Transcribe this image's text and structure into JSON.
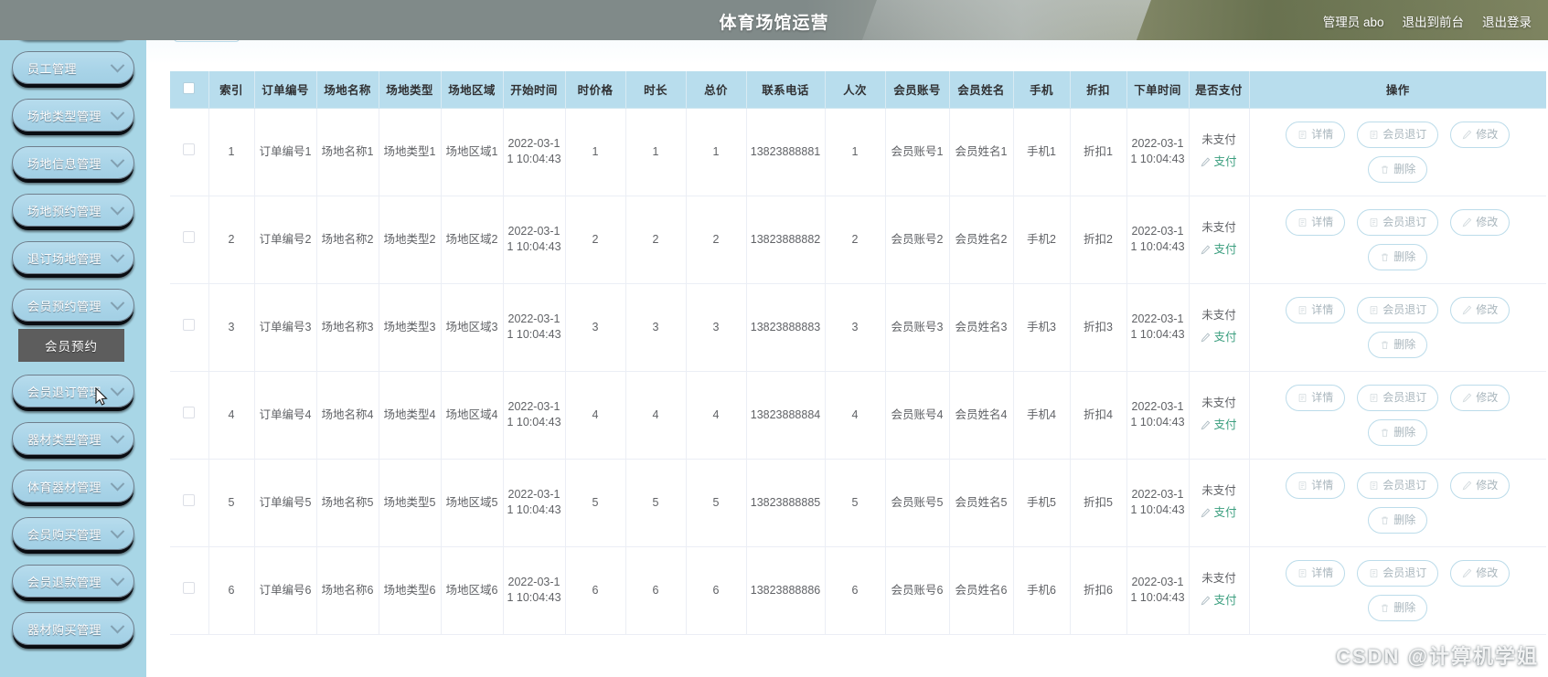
{
  "header": {
    "title": "体育场馆运营",
    "right_items": [
      {
        "label": "管理员 abo",
        "name": "admin-user"
      },
      {
        "label": "退出到前台",
        "name": "exit-to-frontend"
      },
      {
        "label": "退出登录",
        "name": "logout"
      }
    ]
  },
  "sidebar": {
    "items": [
      {
        "label": "员工管理",
        "icon": "chevron-down-icon",
        "expanded": false
      },
      {
        "label": "场地类型管理",
        "icon": "chevron-down-icon",
        "expanded": false
      },
      {
        "label": "场地信息管理",
        "icon": "chevron-down-icon",
        "expanded": false
      },
      {
        "label": "场地预约管理",
        "icon": "chevron-down-icon",
        "expanded": false
      },
      {
        "label": "退订场地管理",
        "icon": "chevron-down-icon",
        "expanded": false
      },
      {
        "label": "会员预约管理",
        "icon": "chevron-down-icon",
        "expanded": true
      },
      {
        "label": "会员退订管理",
        "icon": "chevron-down-icon",
        "expanded": false
      },
      {
        "label": "器材类型管理",
        "icon": "chevron-down-icon",
        "expanded": false
      },
      {
        "label": "体育器材管理",
        "icon": "chevron-down-icon",
        "expanded": false
      },
      {
        "label": "会员购买管理",
        "icon": "chevron-down-icon",
        "expanded": false
      },
      {
        "label": "会员退款管理",
        "icon": "chevron-down-icon",
        "expanded": false
      },
      {
        "label": "器材购买管理",
        "icon": "chevron-down-icon",
        "expanded": false
      }
    ],
    "submenu_after_index": 5,
    "submenu_label": "会员预约"
  },
  "table": {
    "columns": [
      "",
      "索引",
      "订单编号",
      "场地名称",
      "场地类型",
      "场地区域",
      "开始时间",
      "时价格",
      "时长",
      "总价",
      "联系电话",
      "人次",
      "会员账号",
      "会员姓名",
      "手机",
      "折扣",
      "下单时间",
      "是否支付",
      "操作"
    ],
    "rows": [
      {
        "index": "1",
        "order_no": "订单编号1",
        "venue_name": "场地名称1",
        "venue_type": "场地类型1",
        "venue_area": "场地区域1",
        "start_time": "2022-03-11 10:04:43",
        "hour_price": "1",
        "duration": "1",
        "total": "1",
        "phone_contact": "13823888881",
        "person_count": "1",
        "member_account": "会员账号1",
        "member_name": "会员姓名1",
        "mobile": "手机1",
        "discount": "折扣1",
        "order_time": "2022-03-11 10:04:43",
        "pay_state": "未支付",
        "pay_link": "支付"
      },
      {
        "index": "2",
        "order_no": "订单编号2",
        "venue_name": "场地名称2",
        "venue_type": "场地类型2",
        "venue_area": "场地区域2",
        "start_time": "2022-03-11 10:04:43",
        "hour_price": "2",
        "duration": "2",
        "total": "2",
        "phone_contact": "13823888882",
        "person_count": "2",
        "member_account": "会员账号2",
        "member_name": "会员姓名2",
        "mobile": "手机2",
        "discount": "折扣2",
        "order_time": "2022-03-11 10:04:43",
        "pay_state": "未支付",
        "pay_link": "支付"
      },
      {
        "index": "3",
        "order_no": "订单编号3",
        "venue_name": "场地名称3",
        "venue_type": "场地类型3",
        "venue_area": "场地区域3",
        "start_time": "2022-03-11 10:04:43",
        "hour_price": "3",
        "duration": "3",
        "total": "3",
        "phone_contact": "13823888883",
        "person_count": "3",
        "member_account": "会员账号3",
        "member_name": "会员姓名3",
        "mobile": "手机3",
        "discount": "折扣3",
        "order_time": "2022-03-11 10:04:43",
        "pay_state": "未支付",
        "pay_link": "支付"
      },
      {
        "index": "4",
        "order_no": "订单编号4",
        "venue_name": "场地名称4",
        "venue_type": "场地类型4",
        "venue_area": "场地区域4",
        "start_time": "2022-03-11 10:04:43",
        "hour_price": "4",
        "duration": "4",
        "total": "4",
        "phone_contact": "13823888884",
        "person_count": "4",
        "member_account": "会员账号4",
        "member_name": "会员姓名4",
        "mobile": "手机4",
        "discount": "折扣4",
        "order_time": "2022-03-11 10:04:43",
        "pay_state": "未支付",
        "pay_link": "支付"
      },
      {
        "index": "5",
        "order_no": "订单编号5",
        "venue_name": "场地名称5",
        "venue_type": "场地类型5",
        "venue_area": "场地区域5",
        "start_time": "2022-03-11 10:04:43",
        "hour_price": "5",
        "duration": "5",
        "total": "5",
        "phone_contact": "13823888885",
        "person_count": "5",
        "member_account": "会员账号5",
        "member_name": "会员姓名5",
        "mobile": "手机5",
        "discount": "折扣5",
        "order_time": "2022-03-11 10:04:43",
        "pay_state": "未支付",
        "pay_link": "支付"
      },
      {
        "index": "6",
        "order_no": "订单编号6",
        "venue_name": "场地名称6",
        "venue_type": "场地类型6",
        "venue_area": "场地区域6",
        "start_time": "2022-03-11 10:04:43",
        "hour_price": "6",
        "duration": "6",
        "total": "6",
        "phone_contact": "13823888886",
        "person_count": "6",
        "member_account": "会员账号6",
        "member_name": "会员姓名6",
        "mobile": "手机6",
        "discount": "折扣6",
        "order_time": "2022-03-11 10:04:43",
        "pay_state": "未支付",
        "pay_link": "支付"
      }
    ],
    "actions": [
      {
        "label": "详情",
        "icon": "document-icon"
      },
      {
        "label": "会员退订",
        "icon": "document-icon"
      },
      {
        "label": "修改",
        "icon": "edit-icon"
      },
      {
        "label": "删除",
        "icon": "trash-icon"
      }
    ]
  },
  "watermark": {
    "text": "CSDN @计算机学姐"
  },
  "colors": {
    "sidebar_bg": "#a8d6e6",
    "menu_item_bg": "#acd5e8",
    "table_header_bg": "#b8dded",
    "pay_link": "#3a9e7e",
    "button_border": "#bcdcea",
    "header_overlay": "#808a89"
  }
}
